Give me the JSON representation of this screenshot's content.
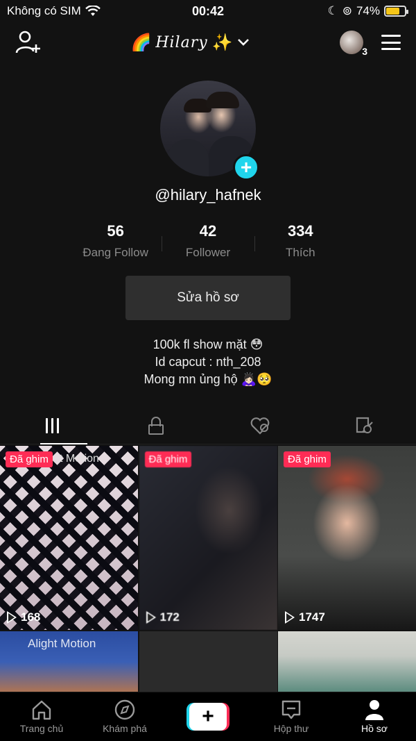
{
  "status_bar": {
    "carrier": "Không có SIM",
    "time": "00:42",
    "battery": "74%",
    "battery_level": 0.74
  },
  "header": {
    "title_prefix_emoji": "🌈",
    "title": "Hilary",
    "title_suffix_emoji": "✨",
    "friends_count": "3"
  },
  "profile": {
    "username": "@hilary_hafnek",
    "stats": [
      {
        "value": "56",
        "label": "Đang Follow"
      },
      {
        "value": "42",
        "label": "Follower"
      },
      {
        "value": "334",
        "label": "Thích"
      }
    ],
    "edit_button": "Sửa hồ sơ",
    "bio": [
      "100k fl show mặt 😳",
      "Id capcut : nth_208",
      "Mong mn ủng hộ 🙇🏻‍♀️🥺"
    ]
  },
  "tabs": [
    {
      "icon": "grid-icon"
    },
    {
      "icon": "lock-icon"
    },
    {
      "icon": "liked-heart-icon"
    },
    {
      "icon": "tagged-icon"
    }
  ],
  "videos": [
    {
      "pinned": "Đã ghim",
      "watermark": "t Motion",
      "views": "168"
    },
    {
      "pinned": "Đã ghim",
      "views": "172"
    },
    {
      "pinned": "Đã ghim",
      "views": "1747"
    },
    {
      "watermark": "Alight Motion"
    },
    {},
    {}
  ],
  "bottom_nav": [
    {
      "label": "Trang chủ",
      "icon": "home-icon"
    },
    {
      "label": "Khám phá",
      "icon": "compass-icon"
    },
    {
      "label": "",
      "icon": "create-plus-icon"
    },
    {
      "label": "Hộp thư",
      "icon": "inbox-icon"
    },
    {
      "label": "Hồ sơ",
      "icon": "profile-icon"
    }
  ]
}
